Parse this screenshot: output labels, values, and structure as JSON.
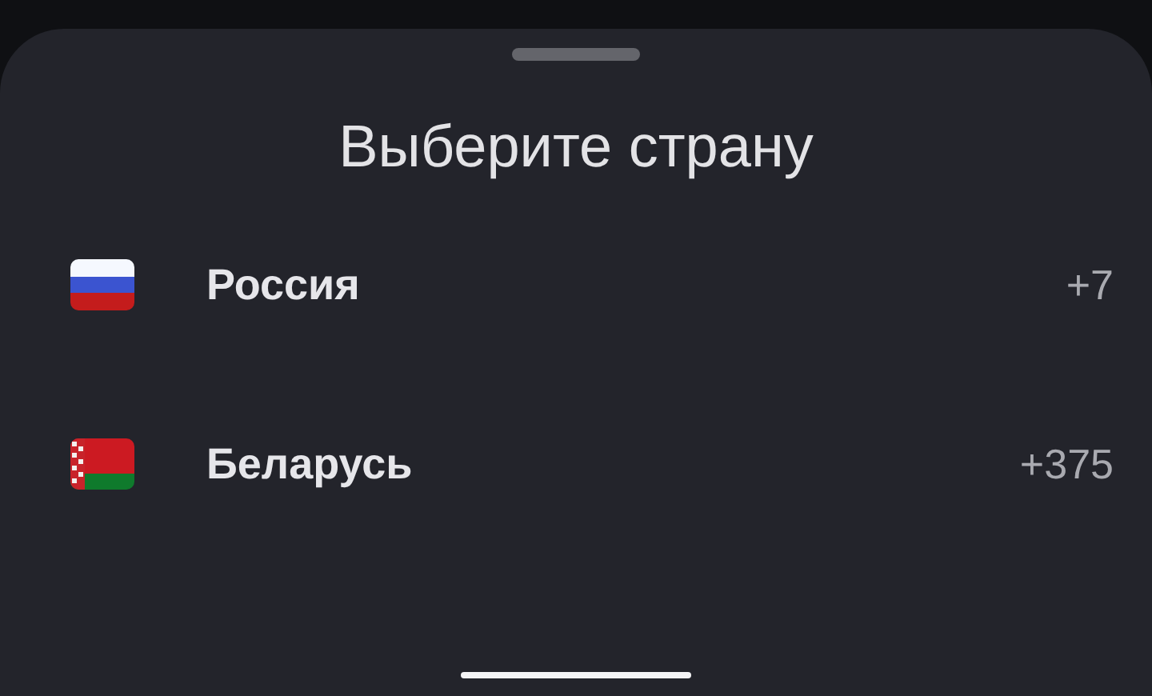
{
  "sheet": {
    "title": "Выберите страну"
  },
  "countries": [
    {
      "kind": "ru",
      "name": "Россия",
      "code": "+7"
    },
    {
      "kind": "by",
      "name": "Беларусь",
      "code": "+375"
    }
  ]
}
